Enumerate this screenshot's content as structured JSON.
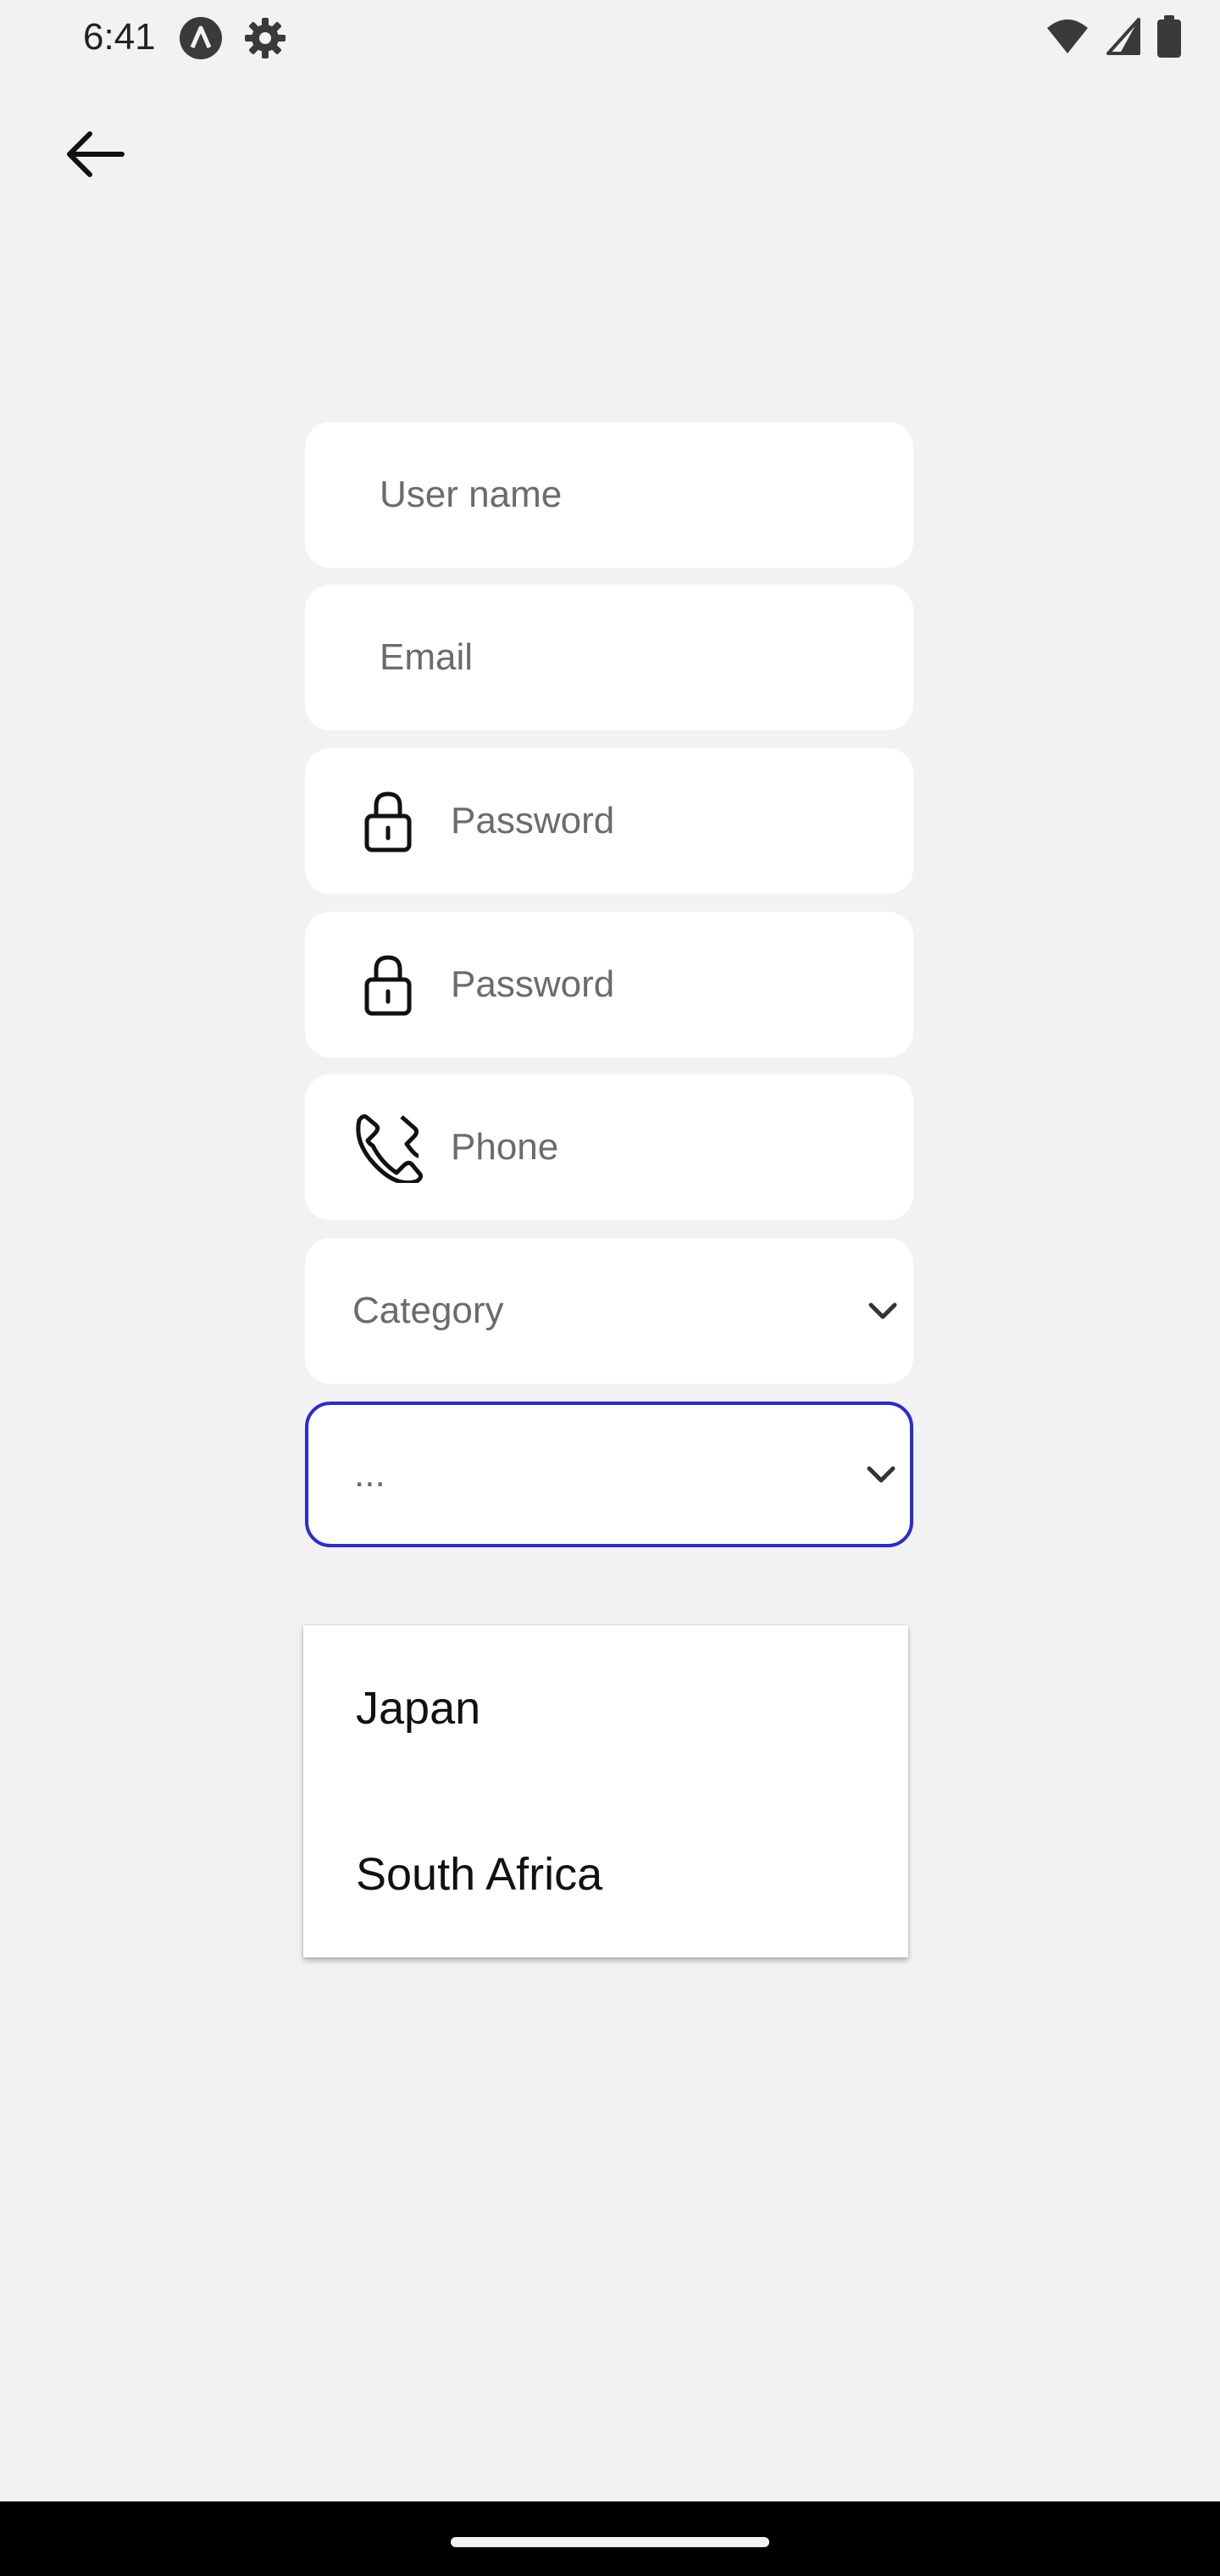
{
  "status_bar": {
    "time": "6:41",
    "icons": [
      "app-a-icon",
      "settings-gear-icon",
      "wifi-icon",
      "signal-icon",
      "battery-icon"
    ]
  },
  "navigation": {
    "back_icon": "arrow-left-icon"
  },
  "form": {
    "username_placeholder": "User name",
    "email_placeholder": "Email",
    "password_placeholder": "Password",
    "confirm_password_placeholder": "Password",
    "phone_placeholder": "Phone",
    "category_placeholder": "Category",
    "country_value": "...",
    "focus_color": "#2a2ad6"
  },
  "dropdown": {
    "options": [
      {
        "label": "Japan"
      },
      {
        "label": "South Africa"
      }
    ]
  }
}
